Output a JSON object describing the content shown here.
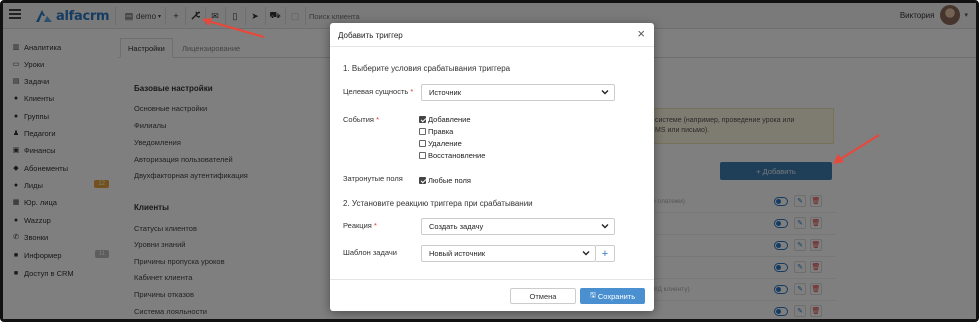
{
  "app": {
    "logo_text": "alfacrm",
    "brand_color": "#2a78c4"
  },
  "topbar": {
    "branch_label": "demo",
    "search_placeholder": "Поиск клиента",
    "user_name": "Виктория",
    "icons": [
      "plus-icon",
      "wrench-icon",
      "envelope-icon",
      "phone-icon",
      "telegram-icon",
      "cart-icon",
      "box-icon"
    ]
  },
  "sidebar": {
    "items": [
      {
        "label": "Аналитика",
        "icon": "chart-icon"
      },
      {
        "label": "Уроки",
        "icon": "calendar-icon"
      },
      {
        "label": "Задачи",
        "icon": "tasks-icon"
      },
      {
        "label": "Клиенты",
        "icon": "user-icon"
      },
      {
        "label": "Группы",
        "icon": "users-icon"
      },
      {
        "label": "Педагоги",
        "icon": "teacher-icon"
      },
      {
        "label": "Финансы",
        "icon": "money-icon"
      },
      {
        "label": "Абонементы",
        "icon": "tag-icon"
      },
      {
        "label": "Лиды",
        "icon": "lead-icon",
        "badge": "12",
        "badge_color": "#e6a23c"
      },
      {
        "label": "Юр. лица",
        "icon": "building-icon"
      },
      {
        "label": "Wazzup",
        "icon": "chat-icon"
      },
      {
        "label": "Звонки",
        "icon": "phone-icon"
      },
      {
        "label": "Информер",
        "icon": "info-icon",
        "badge": "11",
        "badge_color": "#bbbbbb"
      },
      {
        "label": "Доступ в CRM",
        "icon": "lock-icon"
      }
    ]
  },
  "main": {
    "tabs": [
      {
        "label": "Настройки",
        "active": true
      },
      {
        "label": "Лицензирование",
        "active": false
      }
    ],
    "section_base": "Базовые настройки",
    "base_links": [
      "Основные настройки",
      "Филиалы",
      "Уведомления",
      "Авторизация пользователей",
      "Двухфакторная аутентификация"
    ],
    "section_clients": "Клиенты",
    "client_links": [
      "Статусы клиентов",
      "Уровни знаний",
      "Причины пропуска уроков",
      "Кабинет клиента",
      "Причины отказов",
      "Система лояльности"
    ],
    "info_line1": "системе (например, проведение урока или",
    "info_line2": "MS или письмо).",
    "add_button": "+ Добавить",
    "row_hints": [
      "вые платежи)",
      "",
      "",
      "",
      "",
      "",
      "з (Н/Д клиенту)",
      ""
    ]
  },
  "modal": {
    "title": "Добавить триггер",
    "step1": "1. Выберите условия срабатывания триггера",
    "target_label": "Целевая сущность",
    "target_value": "Источник",
    "events_label": "События",
    "events": [
      {
        "label": "Добавление",
        "checked": true
      },
      {
        "label": "Правка",
        "checked": false
      },
      {
        "label": "Удаление",
        "checked": false
      },
      {
        "label": "Восстановление",
        "checked": false
      }
    ],
    "fields_label": "Затронутые поля",
    "any_fields_label": "Любые поля",
    "any_fields_checked": true,
    "step2": "2. Установите реакцию триггера при срабатывании",
    "reaction_label": "Реакция",
    "reaction_value": "Создать задачу",
    "template_label": "Шаблон задачи",
    "template_value": "Новый источник",
    "cancel_label": "Отмена",
    "save_label": "Сохранить"
  },
  "colors": {
    "arrow": "#e8483b",
    "primary_button": "#4a90d0",
    "required": "#dd3333"
  }
}
